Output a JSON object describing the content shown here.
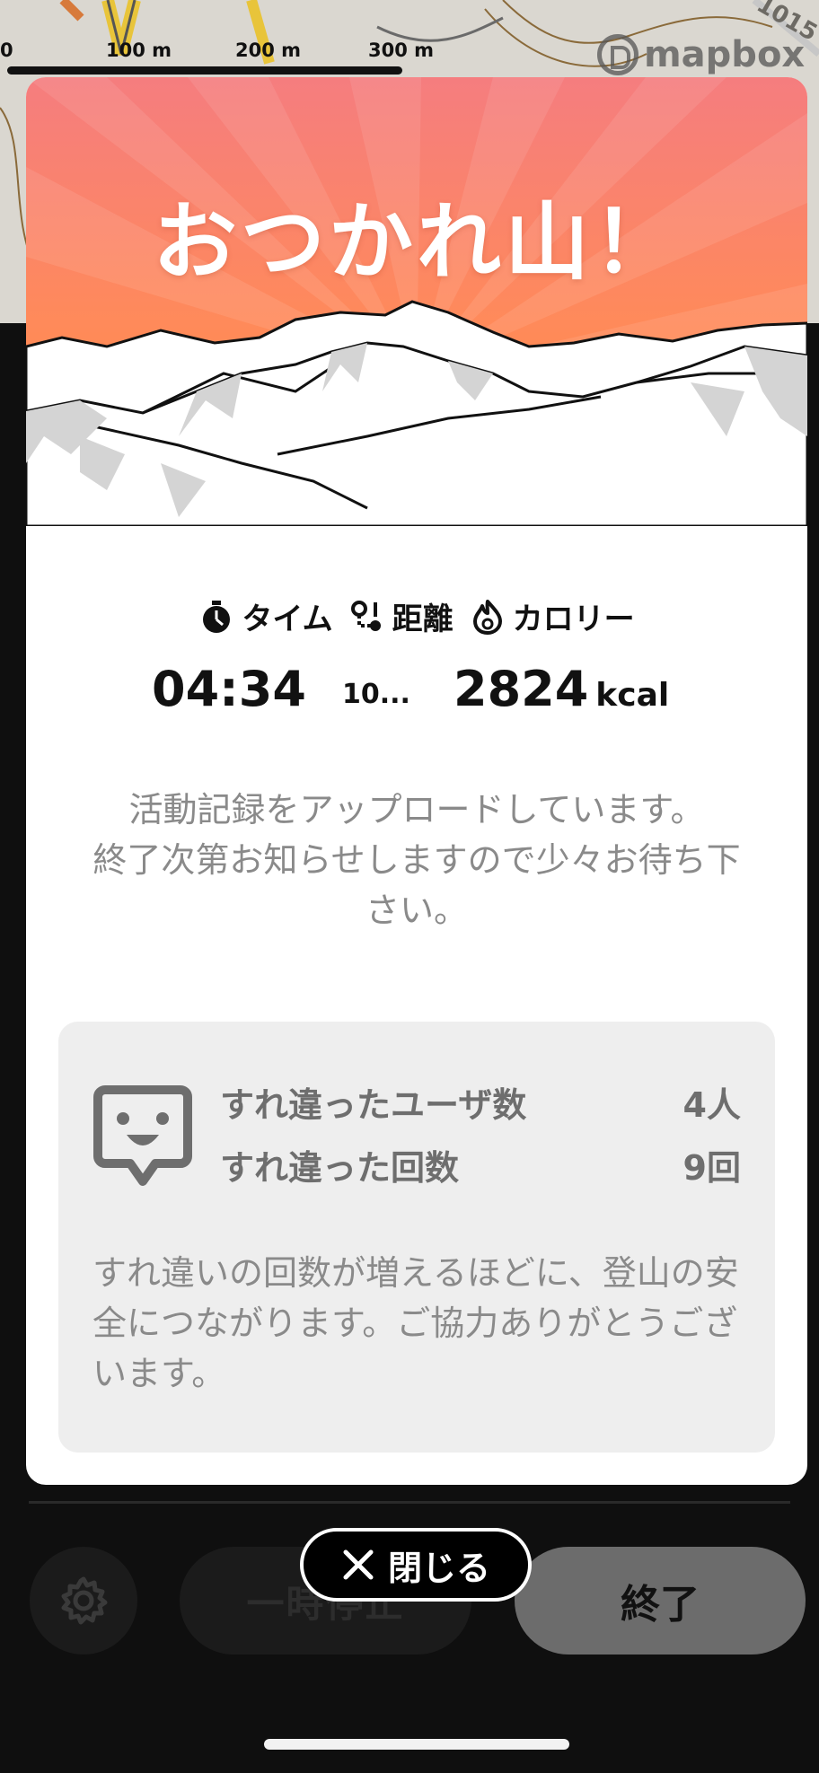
{
  "map": {
    "scale_labels": [
      "0",
      "100 m",
      "200 m",
      "300 m"
    ],
    "road_label": "1015",
    "attribution": "mapbox"
  },
  "modal": {
    "title": "おつかれ山！",
    "stats": {
      "time_label": "タイム",
      "distance_label": "距離",
      "calorie_label": "カロリー",
      "time_value": "04:34",
      "distance_value": "10...",
      "calorie_value": "2824",
      "calorie_unit": "kcal"
    },
    "upload_message_line1": "活動記録をアップロードしています。",
    "upload_message_line2": "終了次第お知らせしますので少々お待ち下さい。",
    "passing": {
      "users_label": "すれ違ったユーザ数",
      "users_value": "4人",
      "count_label": "すれ違った回数",
      "count_value": "9回",
      "note": "すれ違いの回数が増えるほどに、登山の安全につながります。ご協力ありがとうございます。"
    }
  },
  "controls": {
    "pause_label": "一時停止",
    "finish_label": "終了",
    "close_label": "閉じる"
  },
  "colors": {
    "hero_top": "#f57f7c",
    "hero_bottom": "#ff8a3d",
    "finish_button": "#6c6c6c"
  }
}
